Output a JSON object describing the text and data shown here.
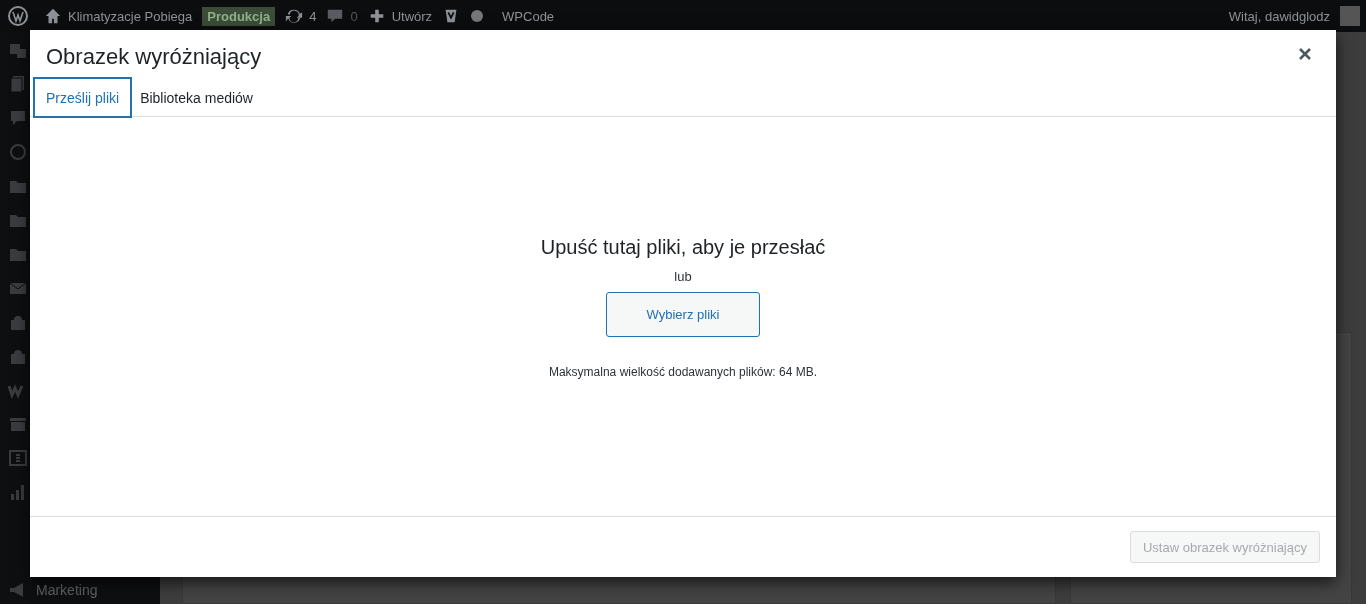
{
  "admin_bar": {
    "site_name": "Klimatyzacje Pobiega",
    "environment_badge": "Produkcja",
    "updates_count": "4",
    "comments_count": "0",
    "new_label": "Utwórz",
    "plugin_label": "WPCode",
    "greeting": "Witaj, dawidglodz"
  },
  "sidebar": {
    "items": [
      {
        "label": "Marketing"
      }
    ]
  },
  "modal": {
    "title": "Obrazek wyróżniający",
    "tabs": [
      {
        "label": "Prześlij pliki",
        "selected": true
      },
      {
        "label": "Biblioteka mediów",
        "selected": false
      }
    ],
    "uploader": {
      "heading": "Upuść tutaj pliki, aby je przesłać",
      "separator": "lub",
      "button": "Wybierz pliki",
      "max_size_note": "Maksymalna wielkość dodawanych plików: 64 MB."
    },
    "footer": {
      "primary_button": {
        "label": "Ustaw obrazek wyróżniający",
        "disabled": true
      }
    }
  }
}
